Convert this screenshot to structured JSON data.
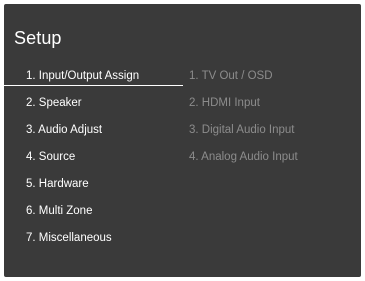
{
  "title": "Setup",
  "menu": [
    "1. Input/Output Assign",
    "2. Speaker",
    "3. Audio Adjust",
    "4. Source",
    "5. Hardware",
    "6. Multi Zone",
    "7. Miscellaneous"
  ],
  "submenu": [
    "1. TV Out / OSD",
    "2. HDMI Input",
    "3. Digital Audio Input",
    "4. Analog Audio Input"
  ]
}
